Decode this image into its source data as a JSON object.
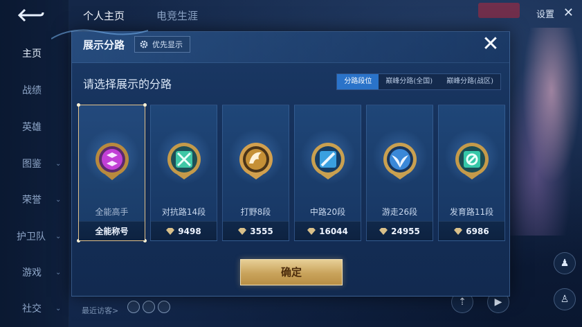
{
  "nav": {
    "items": [
      {
        "label": "主页",
        "active": true
      },
      {
        "label": "战绩"
      },
      {
        "label": "英雄"
      },
      {
        "label": "图鉴"
      },
      {
        "label": "荣誉"
      },
      {
        "label": "护卫队"
      },
      {
        "label": "游戏"
      },
      {
        "label": "社交"
      }
    ]
  },
  "top_tabs": [
    "个人主页",
    "电竞生涯"
  ],
  "top_right": {
    "settings_label": "设置"
  },
  "footer": {
    "recent_visitors_label": "最近访客>"
  },
  "modal": {
    "title": "展示分路",
    "priority_label": "优先显示",
    "close_symbol": "✕",
    "prompt": "请选择展示的分路",
    "tabs": [
      {
        "label": "分路段位",
        "active": true
      },
      {
        "label": "巅峰分路(全国)"
      },
      {
        "label": "巅峰分路(战区)"
      }
    ],
    "cards": [
      {
        "name": "全能高手",
        "value": "全能称号",
        "selected": true,
        "color": "#c23fd6",
        "icon": "allround-emblem-icon"
      },
      {
        "name": "对抗路14段",
        "value": "9498",
        "color": "#3fc7a6",
        "icon": "clash-lane-emblem-icon"
      },
      {
        "name": "打野8段",
        "value": "3555",
        "color": "#c59036",
        "icon": "jungle-emblem-icon"
      },
      {
        "name": "中路20段",
        "value": "16044",
        "color": "#3aa0e0",
        "icon": "mid-lane-emblem-icon"
      },
      {
        "name": "游走26段",
        "value": "24955",
        "color": "#3a88d8",
        "icon": "roam-emblem-icon"
      },
      {
        "name": "发育路11段",
        "value": "6986",
        "color": "#36c7a8",
        "icon": "farm-lane-emblem-icon"
      }
    ],
    "confirm_label": "确定"
  }
}
